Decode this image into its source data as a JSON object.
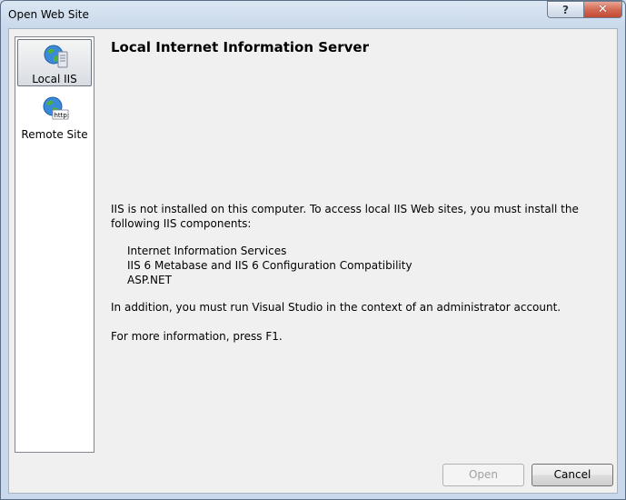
{
  "window": {
    "title": "Open Web Site",
    "help_glyph": "?",
    "close_glyph": "✕"
  },
  "sidebar": {
    "items": [
      {
        "label": "Local IIS",
        "icon": "globe-server-icon",
        "selected": true
      },
      {
        "label": "Remote Site",
        "icon": "globe-http-icon",
        "selected": false
      }
    ]
  },
  "main": {
    "heading": "Local Internet Information Server",
    "message_line1": "IIS is not installed on this computer. To access local IIS Web sites, you must install the following IIS components:",
    "components": [
      "Internet Information Services",
      "IIS 6 Metabase and IIS 6 Configuration Compatibility",
      "ASP.NET"
    ],
    "message_admin": "In addition, you must run Visual Studio in the context of an administrator account.",
    "message_help": "For more information, press F1."
  },
  "buttons": {
    "open": "Open",
    "cancel": "Cancel"
  },
  "colors": {
    "close_button": "#c34a33",
    "selection_border": "#6b7280"
  }
}
